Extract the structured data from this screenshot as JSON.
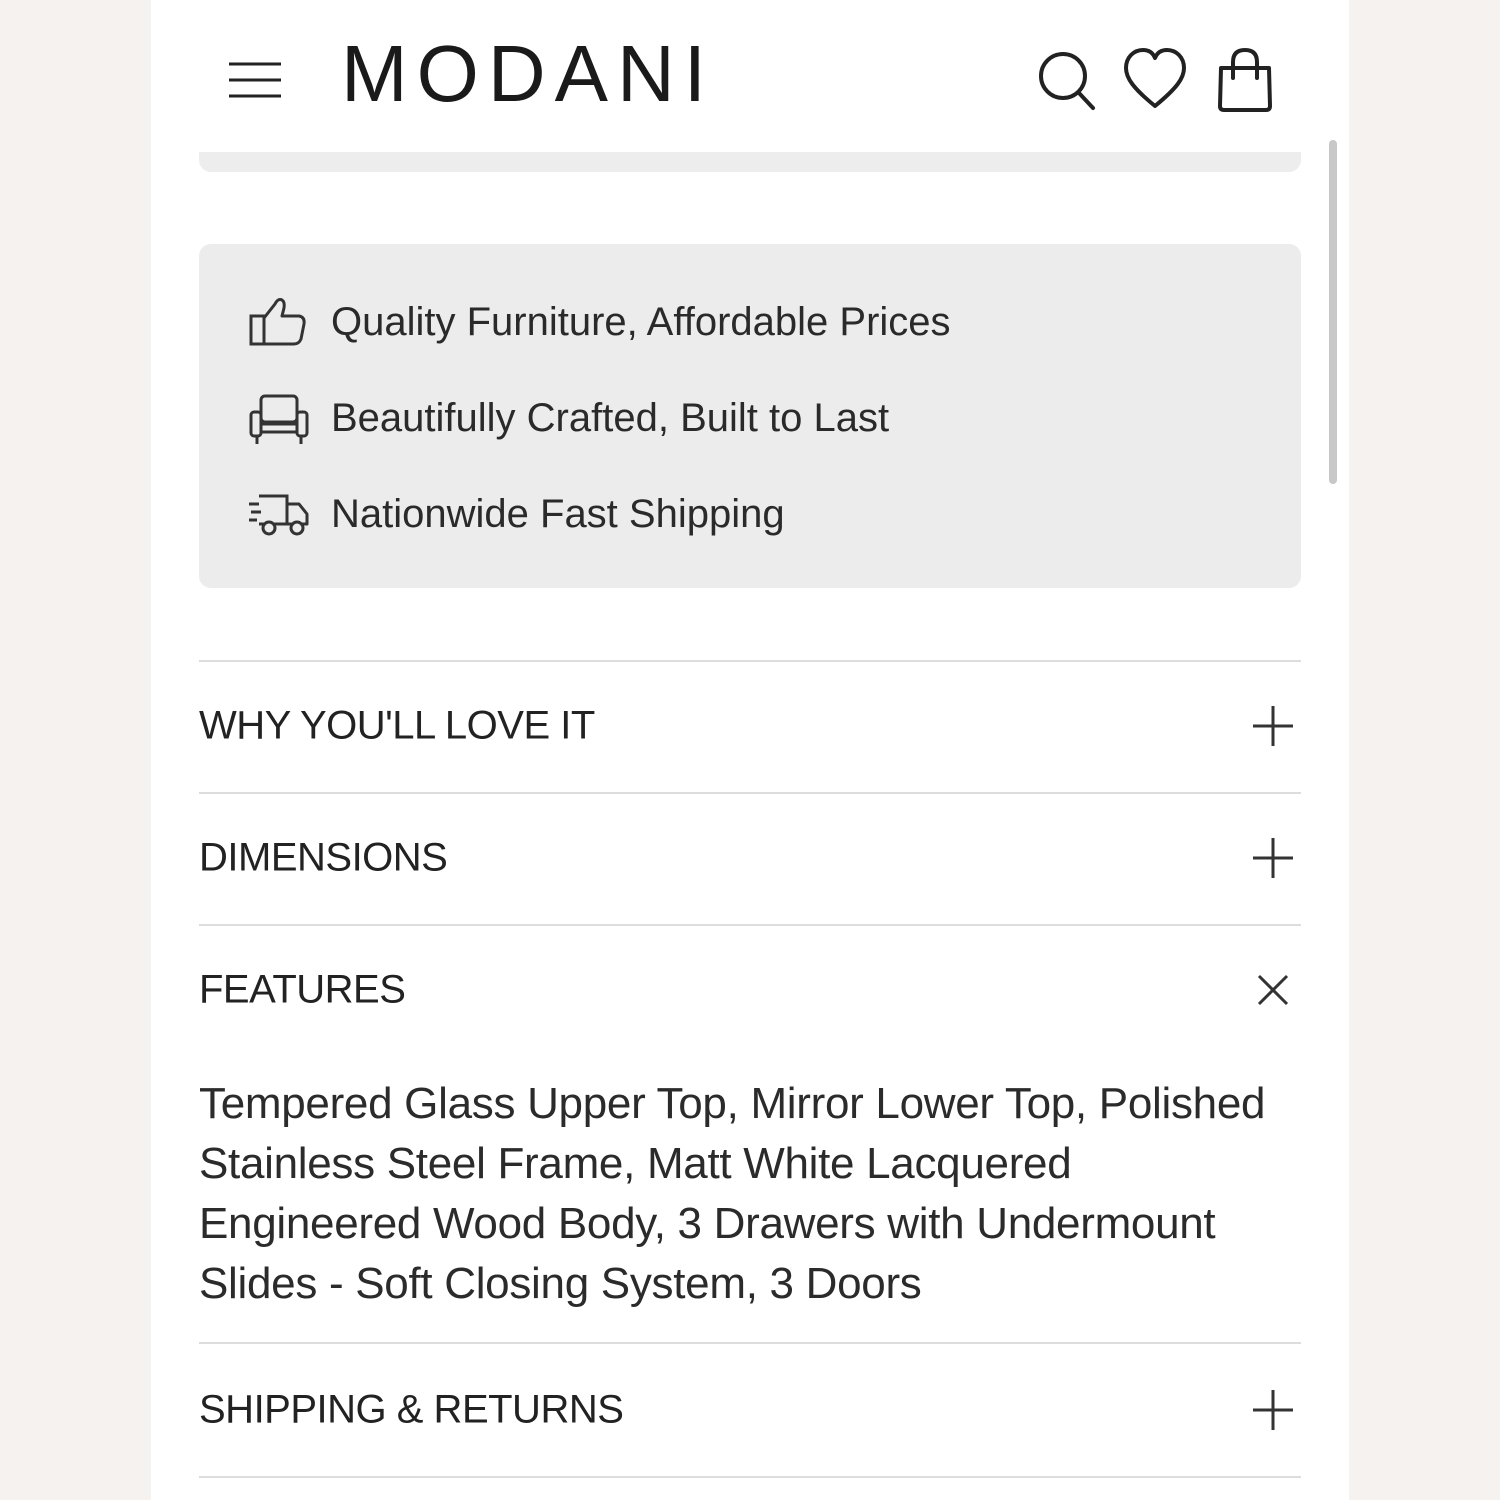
{
  "header": {
    "brand": "MODANI",
    "icons": [
      "menu-icon",
      "search-icon",
      "heart-icon",
      "shopping-bag-icon"
    ]
  },
  "benefits": [
    {
      "icon": "thumbs-up-icon",
      "label": "Quality Furniture, Affordable Prices"
    },
    {
      "icon": "armchair-icon",
      "label": "Beautifully Crafted, Built to Last"
    },
    {
      "icon": "delivery-truck-icon",
      "label": "Nationwide Fast Shipping"
    }
  ],
  "accordion": [
    {
      "title": "WHY YOU'LL LOVE IT",
      "state": "collapsed",
      "toggle_icon": "plus-icon"
    },
    {
      "title": "DIMENSIONS",
      "state": "collapsed",
      "toggle_icon": "plus-icon"
    },
    {
      "title": "FEATURES",
      "state": "expanded",
      "toggle_icon": "close-icon",
      "body": "Tempered Glass Upper Top, Mirror Lower Top, Polished Stainless Steel Frame, Matt White Lacquered Engineered Wood Body, 3 Drawers with Undermount Slides - Soft Closing System, 3 Doors"
    },
    {
      "title": "SHIPPING & RETURNS",
      "state": "collapsed",
      "toggle_icon": "plus-icon"
    }
  ],
  "colors": {
    "page_background": "#ffffff",
    "outer_background": "#f5f2ef",
    "benefits_panel": "#ececec",
    "text": "#1f1f1f",
    "divider": "#dddddd"
  }
}
